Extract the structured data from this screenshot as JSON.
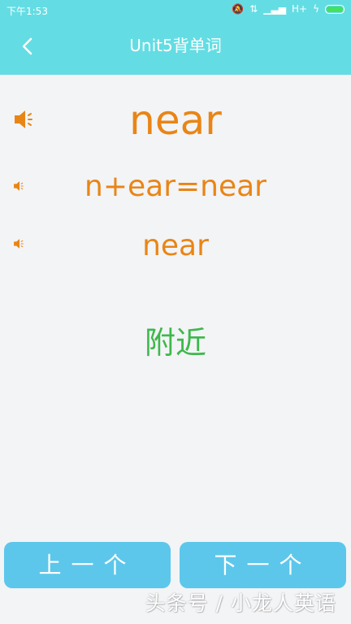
{
  "status_bar": {
    "time": "下午1:53",
    "network": "H+",
    "icons": [
      "mute-icon",
      "data-transfer-icon",
      "signal-icon",
      "network-type-icon",
      "charging-icon",
      "battery-icon"
    ]
  },
  "header": {
    "title": "Unit5背单词",
    "back_icon": "chevron-left-icon"
  },
  "word_card": {
    "word": "near",
    "phonics_split": "n+ear=near",
    "word_repeat": "near",
    "meaning": "附近"
  },
  "buttons": {
    "prev_label": "上一个",
    "next_label": "下一个"
  },
  "watermark": {
    "text": "头条号 / 小龙人英语"
  },
  "colors": {
    "header_bg": "#63dde3",
    "word": "#e98515",
    "meaning": "#3db84b",
    "button_bg": "#5cc7eb",
    "page_bg": "#f3f4f6"
  }
}
